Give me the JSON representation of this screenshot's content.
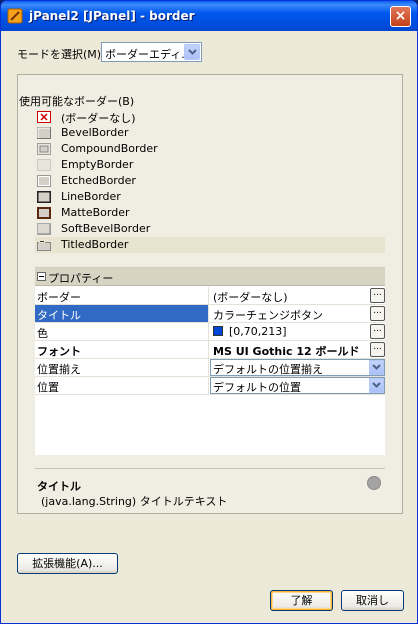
{
  "window": {
    "title": "jPanel2 [JPanel] - border",
    "close_glyph": "×"
  },
  "mode": {
    "label": "モードを選択(M):",
    "value": "ボーダーエディ..."
  },
  "available": {
    "label": "使用可能なボーダー(B)",
    "items": [
      {
        "label": "(ボーダーなし)",
        "icon": "no-border-icon"
      },
      {
        "label": "BevelBorder",
        "icon": "bevel-border-icon"
      },
      {
        "label": "CompoundBorder",
        "icon": "compound-border-icon"
      },
      {
        "label": "EmptyBorder",
        "icon": "empty-border-icon"
      },
      {
        "label": "EtchedBorder",
        "icon": "etched-border-icon"
      },
      {
        "label": "LineBorder",
        "icon": "line-border-icon"
      },
      {
        "label": "MatteBorder",
        "icon": "matte-border-icon"
      },
      {
        "label": "SoftBevelBorder",
        "icon": "soft-bevel-border-icon"
      },
      {
        "label": "TitledBorder",
        "icon": "titled-border-icon",
        "selected": true
      }
    ]
  },
  "properties": {
    "header": "プロパティー",
    "rows": [
      {
        "name": "ボーダー",
        "value": "(ボーダーなし)"
      },
      {
        "name": "タイトル",
        "value": "カラーチェンジボタン"
      },
      {
        "name": "色",
        "value": "[0,70,213]",
        "color": "#0046d5"
      },
      {
        "name": "フォント",
        "value": "MS UI Gothic 12 ボールド"
      },
      {
        "name": "位置揃え",
        "value": "デフォルトの位置揃え"
      },
      {
        "name": "位置",
        "value": "デフォルトの位置"
      }
    ]
  },
  "description": {
    "title": "タイトル",
    "text": "(java.lang.String) タイトルテキスト"
  },
  "buttons": {
    "advanced": "拡張機能(A)...",
    "ok": "了解",
    "cancel": "取消し"
  },
  "colors": {
    "titlebar": "#0058ee",
    "selection": "#316ac5",
    "window_bg": "#ece9d8"
  }
}
